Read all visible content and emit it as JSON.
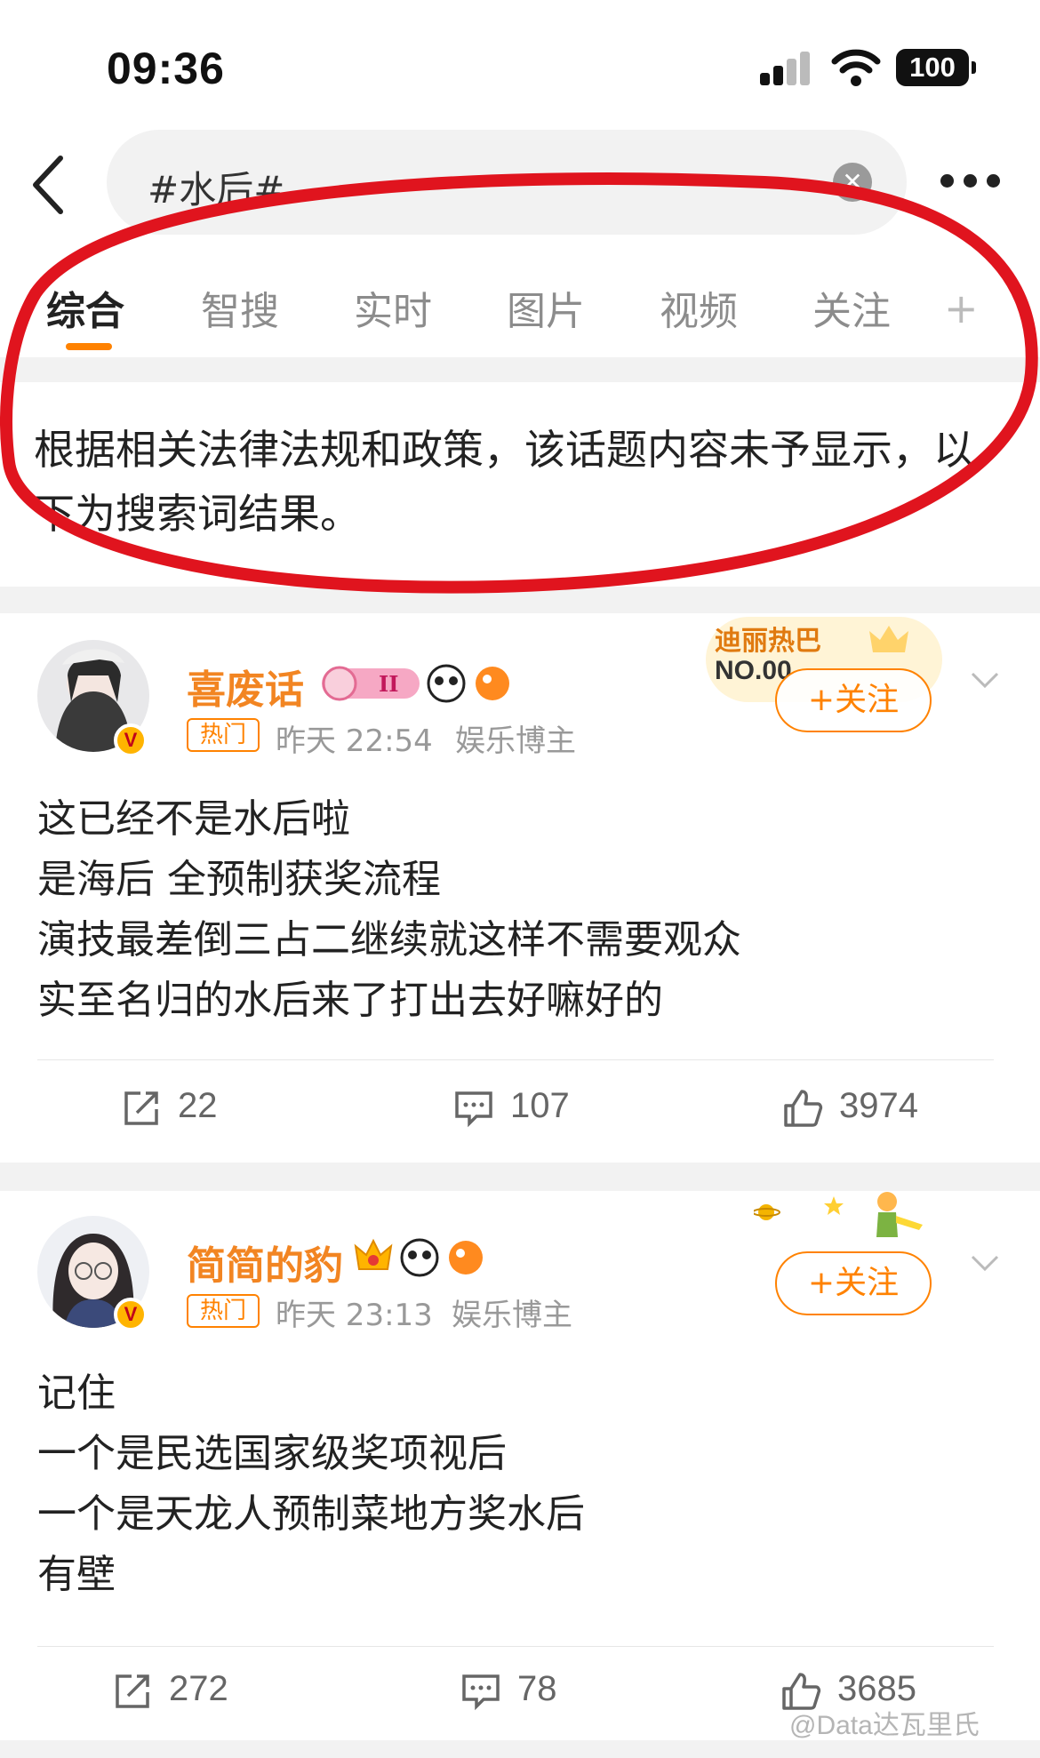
{
  "status_bar": {
    "time": "09:36",
    "battery": "100"
  },
  "search": {
    "query": "#水后#"
  },
  "tabs": [
    {
      "label": "综合",
      "active": true
    },
    {
      "label": "智搜"
    },
    {
      "label": "实时"
    },
    {
      "label": "图片"
    },
    {
      "label": "视频"
    },
    {
      "label": "关注"
    }
  ],
  "tab_more": "+",
  "notice": "根据相关法律法规和政策，该话题内容未予显示，以下为搜索词结果。",
  "colors": {
    "accent": "#ff8200",
    "username": "#f28522",
    "annotation": "#e0141e"
  },
  "posts": [
    {
      "username": "喜废话",
      "badge_level": "II",
      "hot_tag": "热门",
      "time": "昨天 22:54",
      "role": "娱乐博主",
      "follow_label": "+关注",
      "rank_title": "迪丽热巴",
      "rank_no": "NO.00",
      "content": [
        "这已经不是水后啦",
        "是海后 全预制获奖流程",
        "演技最差倒三占二继续就这样不需要观众",
        "实至名归的水后来了打出去好嘛好的"
      ],
      "reposts": "22",
      "comments": "107",
      "likes": "3974"
    },
    {
      "username": "简简的豹",
      "hot_tag": "热门",
      "time": "昨天 23:13",
      "role": "娱乐博主",
      "follow_label": "+关注",
      "content": [
        "记住",
        "一个是民选国家级奖项视后",
        "一个是天龙人预制菜地方奖水后",
        "有壁"
      ],
      "reposts": "272",
      "comments": "78",
      "likes": "3685"
    }
  ],
  "watermark": "@Data达瓦里氏"
}
